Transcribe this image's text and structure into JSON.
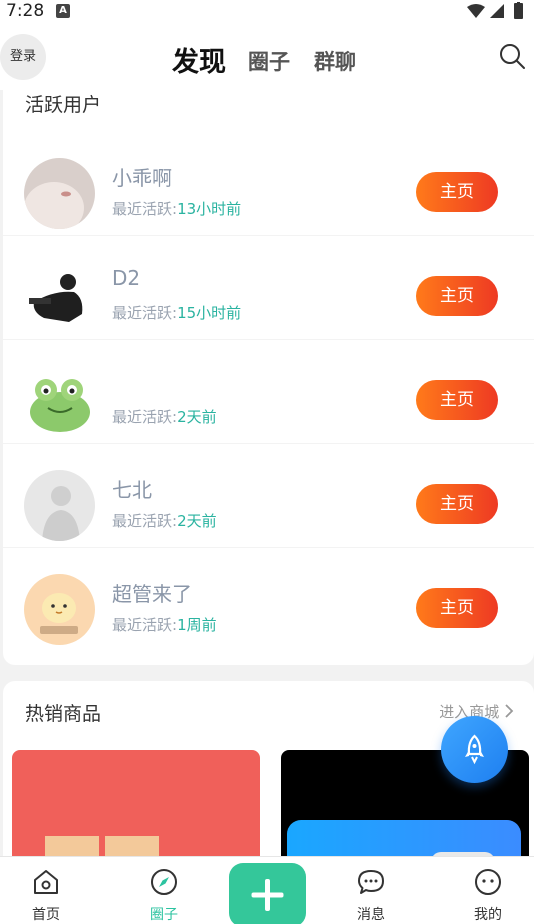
{
  "status_bar": {
    "time": "7:28",
    "notif_letter": "A"
  },
  "header": {
    "login_label": "登录",
    "tabs": [
      "发现",
      "圈子",
      "群聊"
    ]
  },
  "active_users": {
    "title": "活跃用户",
    "active_prefix": "最近活跃:",
    "home_label": "主页",
    "users": [
      {
        "name": "小乖啊",
        "last_active": "13小时前"
      },
      {
        "name": "D2",
        "last_active": "15小时前"
      },
      {
        "name": "",
        "last_active": "2天前"
      },
      {
        "name": "七北",
        "last_active": "2天前"
      },
      {
        "name": "超管来了",
        "last_active": "1周前"
      }
    ]
  },
  "hot_goods": {
    "title": "热销商品",
    "more_label": "进入商城"
  },
  "bottom_nav": {
    "items": [
      {
        "label": "首页"
      },
      {
        "label": "圈子"
      },
      {
        "label": "消息"
      },
      {
        "label": "我的"
      }
    ]
  },
  "colors": {
    "accent_orange": "#ff7a1a",
    "accent_red": "#ee3a23",
    "accent_green": "#2cc3a0",
    "fab_blue": "#1e7ff0"
  }
}
